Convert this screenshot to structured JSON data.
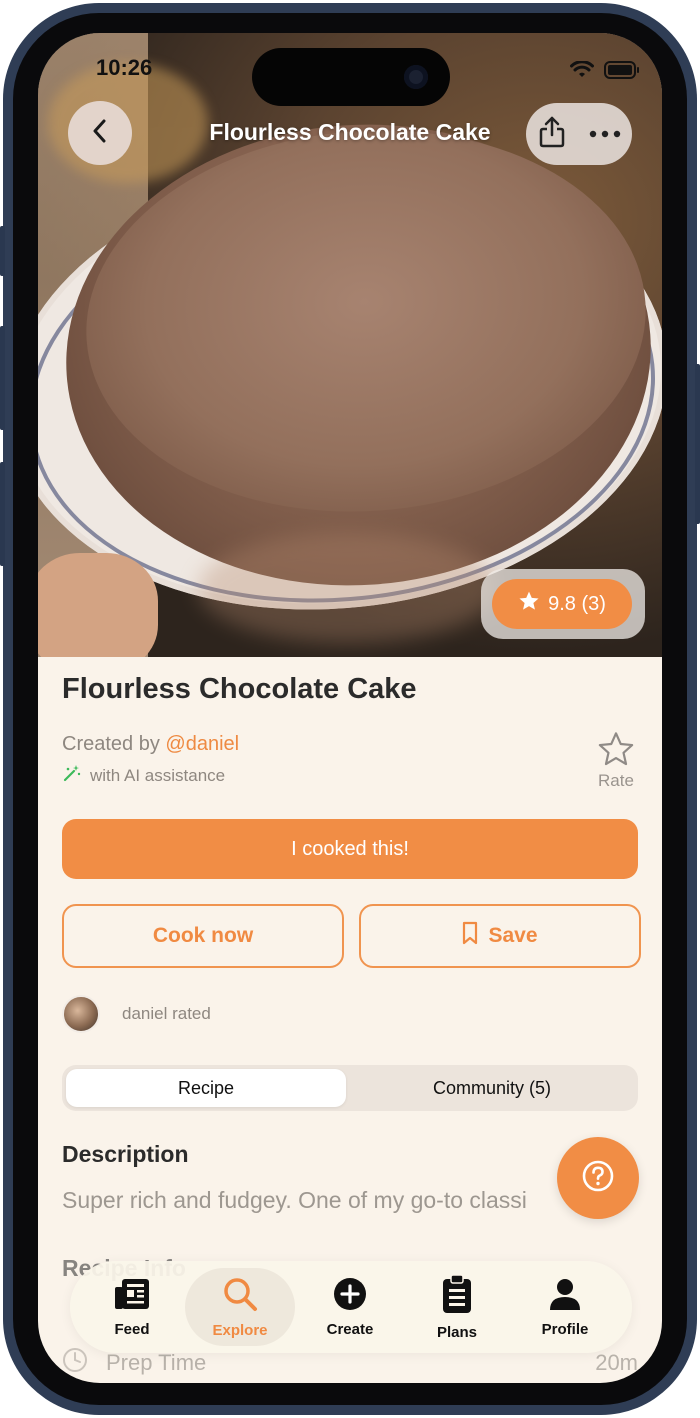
{
  "status_bar": {
    "time": "10:26"
  },
  "header": {
    "title": "Flourless Chocolate Cake"
  },
  "hero": {
    "rating_label": "9.8 (3)"
  },
  "recipe": {
    "title": "Flourless Chocolate Cake",
    "created_by_prefix": "Created by ",
    "author_handle": "@daniel",
    "ai_note": "with AI assistance",
    "rate_label": "Rate"
  },
  "actions": {
    "cooked_label": "I cooked this!",
    "cook_now_label": "Cook now",
    "save_label": "Save"
  },
  "activity": {
    "rated_text": "daniel rated"
  },
  "tabs": {
    "recipe": "Recipe",
    "community": "Community (5)"
  },
  "description": {
    "heading": "Description",
    "text": "Super rich and fudgey. One of my go-to classi"
  },
  "recipe_info": {
    "heading": "Recipe Info",
    "prep_label": "Prep Time",
    "prep_value": "20m"
  },
  "tabbar": {
    "items": [
      {
        "label": "Feed",
        "icon": "feed-icon"
      },
      {
        "label": "Explore",
        "icon": "search-icon"
      },
      {
        "label": "Create",
        "icon": "plus-circle-icon"
      },
      {
        "label": "Plans",
        "icon": "clipboard-icon"
      },
      {
        "label": "Profile",
        "icon": "person-icon"
      }
    ],
    "active": "Explore"
  },
  "colors": {
    "accent": "#f18d45",
    "background": "#faf3ea",
    "frame": "#2f3d55"
  }
}
